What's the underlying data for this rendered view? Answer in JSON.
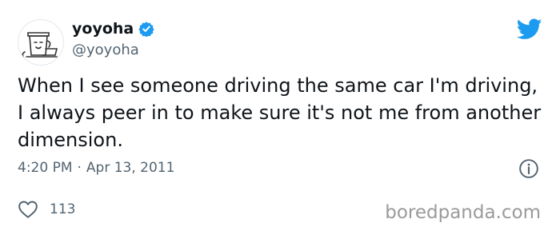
{
  "tweet": {
    "display_name": "yoyoha",
    "handle": "@yoyoha",
    "text": "When I see someone driving the same car I'm driving, I always peer in to make sure it's not me from another dimension.",
    "time": "4:20 PM",
    "separator": "·",
    "date": "Apr 13, 2011",
    "likes": "113"
  },
  "icons": {
    "avatar": "coffee-cup-laptop-doodle",
    "verified": "verified-badge-icon",
    "logo": "twitter-bird-icon",
    "info": "info-icon",
    "like": "heart-icon"
  },
  "colors": {
    "brand_blue": "#1d9bf0",
    "text": "#0f1419",
    "muted": "#536471"
  },
  "watermark": "boredpanda.com"
}
